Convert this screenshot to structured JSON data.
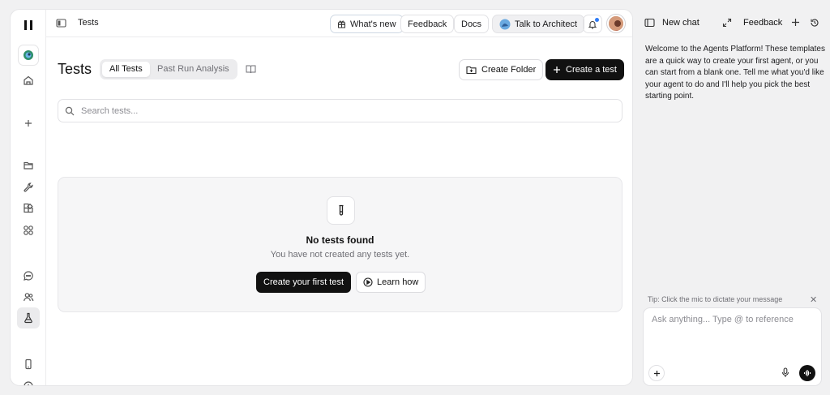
{
  "header": {
    "page_title": "Tests",
    "whats_new_label": "What's new",
    "feedback_label": "Feedback",
    "docs_label": "Docs",
    "talk_label": "Talk to Architect"
  },
  "main": {
    "title": "Tests",
    "tabs": [
      {
        "label": "All Tests",
        "active": true
      },
      {
        "label": "Past Run Analysis",
        "active": false
      }
    ],
    "create_folder_label": "Create Folder",
    "create_test_label": "Create a test",
    "search_placeholder": "Search tests...",
    "empty_state": {
      "title": "No tests found",
      "subtitle": "You have not created any tests yet.",
      "primary_label": "Create your first test",
      "secondary_label": "Learn how"
    }
  },
  "chat": {
    "title": "New chat",
    "feedback_label": "Feedback",
    "welcome": "Welcome to the Agents Platform! These templates are a quick way to create your first agent, or you can start from a blank one. Tell me what you'd like your agent to do and I'll help you pick the best starting point.",
    "tip": "Tip: Click the mic to dictate your message",
    "input_placeholder": "Ask anything... Type @ to reference"
  },
  "colors": {
    "accent_dark": "#111111",
    "panel_bg": "#f1f1f2",
    "notification_dot": "#2f7cf6"
  },
  "icons": [
    "pause-icon",
    "org-logo-icon",
    "home-icon",
    "plus-icon",
    "folder-icon",
    "wrench-icon",
    "blocks-icon",
    "apps-icon",
    "chat-bubble-icon",
    "users-icon",
    "flask-icon",
    "phone-icon",
    "history-icon",
    "sidebar-toggle-icon",
    "gift-icon",
    "bell-icon",
    "book-icon",
    "folder-plus-icon",
    "search-icon",
    "play-circle-icon",
    "expand-icon",
    "mic-icon",
    "waveform-icon",
    "close-icon"
  ]
}
